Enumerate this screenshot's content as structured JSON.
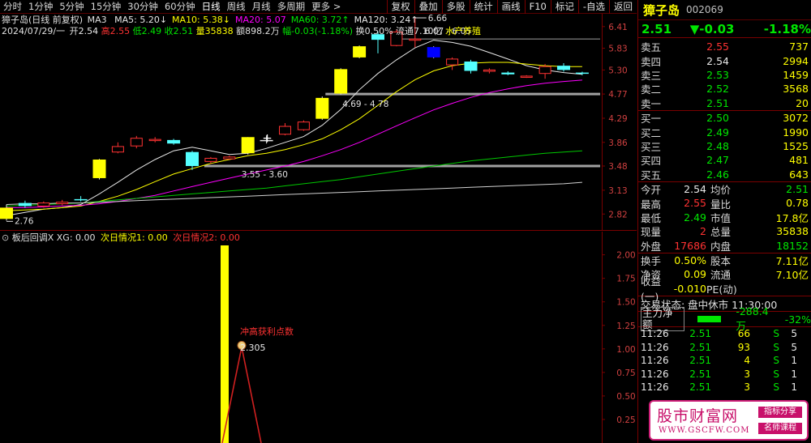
{
  "colors": {
    "up": "#ff3232",
    "down": "#00e600",
    "flat": "#e8e8e8",
    "yellow": "#ffff00",
    "cyan": "#54ffff",
    "blue": "#0000ff",
    "magenta": "#ff00ff",
    "frame": "#7a0000"
  },
  "toolbar": {
    "timeframes": [
      "分时",
      "1分钟",
      "5分钟",
      "15分钟",
      "30分钟",
      "60分钟",
      "日线",
      "周线",
      "月线",
      "多周期",
      "更多 >"
    ],
    "selected": "日线",
    "buttons": [
      "复权",
      "叠加",
      "多股",
      "统计",
      "画线",
      "F10",
      "标记",
      "-自选",
      "返回"
    ]
  },
  "main": {
    "title": "獐子岛(日线 前复权)",
    "ma_label": "MA3",
    "ma_items": [
      {
        "label": "MA5: 5.20↓",
        "color": "#e8e8e8"
      },
      {
        "label": "MA10: 5.38↓",
        "color": "#ffff00"
      },
      {
        "label": "MA20: 5.07",
        "color": "#ff00ff"
      },
      {
        "label": "MA60: 3.72↑",
        "color": "#00e600"
      },
      {
        "label": "MA120: 3.24↑",
        "color": "#e8e8e8"
      }
    ],
    "bar_info": {
      "date": "2024/07/29/一",
      "open_k": "开",
      "open_v": "2.54",
      "high_k": "高",
      "high_v": "2.55",
      "low_k": "低",
      "low_v": "2.49",
      "close_k": "收",
      "close_v": "2.51",
      "vol_k": "量",
      "vol_v": "35838",
      "amt_k": "额",
      "amt_v": "898.2万",
      "chg_k": "幅",
      "chg_v": "-0.03(-1.18%)",
      "turn_k": "换",
      "turn_v": "0.50%",
      "float_k": "流通",
      "float_v": "7.10亿",
      "tag": "水产养殖"
    },
    "y_ticks": [
      "6.41",
      "5.83",
      "5.30",
      "4.77",
      "4.29",
      "3.86",
      "3.48",
      "3.13",
      "2.82"
    ],
    "annotations": {
      "high_mark": "6.66",
      "zone_top": "6.07 - 6.05",
      "zone_mid": "4.69 - 4.78",
      "zone_low": "3.55 - 3.60",
      "low_mark": "2.76"
    }
  },
  "sub": {
    "indicator": "板后回调X",
    "xg": "XG: 0.00",
    "s1": "次日情况1: 0.00",
    "s2": "次日情况2: 0.00",
    "annotation": "冲高获利点数",
    "annotation_value": "2.305",
    "y_ticks": [
      "2.00",
      "1.75",
      "1.50",
      "1.25",
      "1.00",
      "0.75",
      "0.50",
      "0.25"
    ]
  },
  "panel": {
    "name": "獐子岛",
    "code": "002069",
    "price": "2.51",
    "change": "▼-0.03",
    "pct": "-1.18%",
    "asks": [
      {
        "label": "卖五",
        "price": "2.55",
        "vol": "737",
        "pc": "red"
      },
      {
        "label": "卖四",
        "price": "2.54",
        "vol": "2994",
        "pc": "wht"
      },
      {
        "label": "卖三",
        "price": "2.53",
        "vol": "1459",
        "pc": "grn"
      },
      {
        "label": "卖二",
        "price": "2.52",
        "vol": "3568",
        "pc": "grn"
      },
      {
        "label": "卖一",
        "price": "2.51",
        "vol": "20",
        "pc": "grn"
      }
    ],
    "bids": [
      {
        "label": "买一",
        "price": "2.50",
        "vol": "3072",
        "pc": "grn"
      },
      {
        "label": "买二",
        "price": "2.49",
        "vol": "1990",
        "pc": "grn"
      },
      {
        "label": "买三",
        "price": "2.48",
        "vol": "1525",
        "pc": "grn"
      },
      {
        "label": "买四",
        "price": "2.47",
        "vol": "481",
        "pc": "grn"
      },
      {
        "label": "买五",
        "price": "2.46",
        "vol": "643",
        "pc": "grn"
      }
    ],
    "stats1": [
      {
        "k1": "今开",
        "v1": "2.54",
        "c1": "wht",
        "k2": "均价",
        "v2": "2.51",
        "c2": "grn"
      },
      {
        "k1": "最高",
        "v1": "2.55",
        "c1": "red",
        "k2": "量比",
        "v2": "0.78",
        "c2": "yel"
      },
      {
        "k1": "最低",
        "v1": "2.49",
        "c1": "grn",
        "k2": "市值",
        "v2": "17.8亿",
        "c2": "yel"
      },
      {
        "k1": "现量",
        "v1": "2",
        "c1": "red",
        "k2": "总量",
        "v2": "35838",
        "c2": "yel"
      },
      {
        "k1": "外盘",
        "v1": "17686",
        "c1": "red",
        "k2": "内盘",
        "v2": "18152",
        "c2": "grn"
      }
    ],
    "stats2": [
      {
        "k1": "换手",
        "v1": "0.50%",
        "c1": "yel",
        "k2": "股本",
        "v2": "7.11亿",
        "c2": "yel"
      },
      {
        "k1": "净资",
        "v1": "0.09",
        "c1": "yel",
        "k2": "流通",
        "v2": "7.10亿",
        "c2": "yel"
      },
      {
        "k1": "收益(一)",
        "v1": "-0.010",
        "c1": "yel",
        "k2": "PE(动)",
        "v2": "",
        "c2": "yel"
      }
    ],
    "trade_status": "交易状态: 盘中休市 11:30:00",
    "main_flow_label": "主力净额",
    "main_flow_value": "-288.4万",
    "main_flow_pct": "-32%",
    "ticks": [
      {
        "t": "11:26",
        "p": "2.51",
        "v": "66",
        "s": "S",
        "x": "5"
      },
      {
        "t": "11:26",
        "p": "2.51",
        "v": "93",
        "s": "S",
        "x": "5"
      },
      {
        "t": "11:26",
        "p": "2.51",
        "v": "4",
        "s": "S",
        "x": "1"
      },
      {
        "t": "11:26",
        "p": "2.51",
        "v": "3",
        "s": "S",
        "x": "1"
      },
      {
        "t": "11:26",
        "p": "2.51",
        "v": "3",
        "s": "S",
        "x": "1"
      }
    ]
  },
  "watermark": {
    "logo": "股市财富网",
    "url": "WWW.GSCFW.COM",
    "tag1": "指标分享",
    "tag2": "名师课程"
  },
  "chart_data": {
    "type": "candlestick",
    "title": "獐子岛(日线 前复权)",
    "y_ticks": [
      6.41,
      5.83,
      5.3,
      4.77,
      4.29,
      3.86,
      3.48,
      3.13,
      2.82
    ],
    "ylim": [
      2.62,
      6.78
    ],
    "candles": [
      {
        "o": 2.76,
        "c": 2.9,
        "h": 2.94,
        "l": 2.74,
        "style": "yellow"
      },
      {
        "o": 2.96,
        "c": 2.92,
        "h": 2.99,
        "l": 2.9,
        "style": "cyan"
      },
      {
        "o": 2.92,
        "c": 2.96,
        "h": 2.98,
        "l": 2.9,
        "style": "up"
      },
      {
        "o": 2.95,
        "c": 2.97,
        "h": 3.0,
        "l": 2.93,
        "style": "up"
      },
      {
        "o": 3.0,
        "c": 3.01,
        "h": 3.05,
        "l": 2.98,
        "style": "cyan"
      },
      {
        "o": 3.3,
        "c": 3.58,
        "h": 3.59,
        "l": 3.28,
        "style": "yellow"
      },
      {
        "o": 3.7,
        "c": 3.79,
        "h": 3.86,
        "l": 3.68,
        "style": "up"
      },
      {
        "o": 3.8,
        "c": 3.93,
        "h": 3.97,
        "l": 3.76,
        "style": "up"
      },
      {
        "o": 3.9,
        "c": 3.91,
        "h": 3.95,
        "l": 3.86,
        "style": "up"
      },
      {
        "o": 3.9,
        "c": 3.84,
        "h": 3.92,
        "l": 3.82,
        "style": "cyan"
      },
      {
        "o": 3.7,
        "c": 3.48,
        "h": 3.72,
        "l": 3.42,
        "style": "cyan"
      },
      {
        "o": 3.55,
        "c": 3.6,
        "h": 3.62,
        "l": 3.52,
        "style": "up"
      },
      {
        "o": 3.62,
        "c": 3.59,
        "h": 3.64,
        "l": 3.58,
        "style": "up"
      },
      {
        "o": 3.68,
        "c": 3.95,
        "h": 3.95,
        "l": 3.66,
        "style": "yellow"
      },
      {
        "o": 3.9,
        "c": 3.9,
        "h": 3.98,
        "l": 3.84,
        "style": "flat"
      },
      {
        "o": 4.0,
        "c": 4.14,
        "h": 4.2,
        "l": 3.98,
        "style": "up"
      },
      {
        "o": 4.08,
        "c": 4.22,
        "h": 4.25,
        "l": 4.06,
        "style": "up"
      },
      {
        "o": 4.28,
        "c": 4.69,
        "h": 4.72,
        "l": 4.26,
        "style": "yellow"
      },
      {
        "o": 4.78,
        "c": 5.32,
        "h": 5.34,
        "l": 4.76,
        "style": "yellow"
      },
      {
        "o": 5.6,
        "c": 5.88,
        "h": 5.9,
        "l": 5.58,
        "style": "yellow"
      },
      {
        "o": 6.2,
        "c": 6.05,
        "h": 6.28,
        "l": 5.7,
        "style": "cyan"
      },
      {
        "o": 5.9,
        "c": 6.26,
        "h": 6.32,
        "l": 5.88,
        "style": "up"
      },
      {
        "o": 6.07,
        "c": 6.05,
        "h": 6.66,
        "l": 5.85,
        "style": "up"
      },
      {
        "o": 5.86,
        "c": 5.6,
        "h": 5.88,
        "l": 5.58,
        "style": "blue"
      },
      {
        "o": 5.56,
        "c": 5.42,
        "h": 5.6,
        "l": 5.3,
        "style": "up"
      },
      {
        "o": 5.5,
        "c": 5.28,
        "h": 5.54,
        "l": 5.22,
        "style": "cyan"
      },
      {
        "o": 5.3,
        "c": 5.27,
        "h": 5.34,
        "l": 5.22,
        "style": "up"
      },
      {
        "o": 5.24,
        "c": 5.2,
        "h": 5.27,
        "l": 5.18,
        "style": "cyan"
      },
      {
        "o": 5.16,
        "c": 5.14,
        "h": 5.18,
        "l": 5.12,
        "style": "up"
      },
      {
        "o": 5.22,
        "c": 5.38,
        "h": 5.44,
        "l": 5.1,
        "style": "up"
      },
      {
        "o": 5.4,
        "c": 5.3,
        "h": 5.46,
        "l": 5.26,
        "style": "cyan"
      },
      {
        "o": 5.24,
        "c": 5.22,
        "h": 5.26,
        "l": 5.18,
        "style": "cyan"
      }
    ],
    "series": [
      {
        "name": "MA5",
        "color": "#e8e8e8",
        "values": [
          2.8,
          2.84,
          2.88,
          2.9,
          2.94,
          3.08,
          3.24,
          3.42,
          3.58,
          3.72,
          3.78,
          3.72,
          3.66,
          3.68,
          3.76,
          3.86,
          3.96,
          4.16,
          4.46,
          4.86,
          5.22,
          5.54,
          5.84,
          6.04,
          5.98,
          5.88,
          5.72,
          5.56,
          5.4,
          5.3,
          5.24,
          5.2
        ]
      },
      {
        "name": "MA10",
        "color": "#ffff00",
        "values": [
          2.86,
          2.87,
          2.88,
          2.9,
          2.92,
          2.98,
          3.05,
          3.14,
          3.25,
          3.36,
          3.44,
          3.52,
          3.58,
          3.64,
          3.68,
          3.74,
          3.82,
          3.92,
          4.08,
          4.28,
          4.54,
          4.82,
          5.08,
          5.28,
          5.4,
          5.46,
          5.48,
          5.48,
          5.44,
          5.4,
          5.38,
          5.38
        ]
      },
      {
        "name": "MA20",
        "color": "#ff00ff",
        "values": [
          2.9,
          2.9,
          2.91,
          2.92,
          2.93,
          2.95,
          2.98,
          3.02,
          3.06,
          3.12,
          3.18,
          3.24,
          3.3,
          3.36,
          3.42,
          3.48,
          3.55,
          3.64,
          3.74,
          3.86,
          4.0,
          4.15,
          4.3,
          4.45,
          4.58,
          4.7,
          4.8,
          4.88,
          4.95,
          5.0,
          5.04,
          5.07
        ]
      },
      {
        "name": "MA60",
        "color": "#00c800",
        "values": [
          2.92,
          2.93,
          2.94,
          2.95,
          2.96,
          2.98,
          3.0,
          3.02,
          3.04,
          3.06,
          3.08,
          3.1,
          3.12,
          3.14,
          3.16,
          3.19,
          3.22,
          3.25,
          3.28,
          3.32,
          3.36,
          3.4,
          3.44,
          3.48,
          3.52,
          3.56,
          3.59,
          3.62,
          3.65,
          3.68,
          3.7,
          3.72
        ]
      },
      {
        "name": "MA120",
        "color": "#d0d0d0",
        "values": [
          2.94,
          2.95,
          2.95,
          2.96,
          2.96,
          2.97,
          2.98,
          2.99,
          3.0,
          3.01,
          3.02,
          3.03,
          3.04,
          3.05,
          3.06,
          3.07,
          3.08,
          3.09,
          3.1,
          3.11,
          3.12,
          3.13,
          3.14,
          3.15,
          3.16,
          3.17,
          3.18,
          3.19,
          3.2,
          3.21,
          3.22,
          3.24
        ]
      }
    ],
    "indicator": {
      "name": "板后回调X",
      "ylim": [
        0,
        2.1
      ],
      "bar_value": 2.305,
      "peak_value": 1.02
    }
  }
}
